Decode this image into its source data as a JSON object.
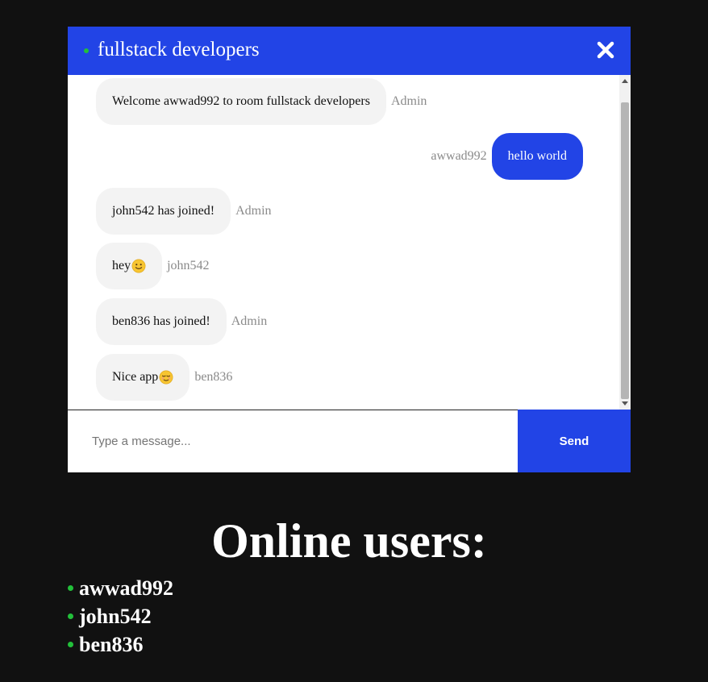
{
  "chat": {
    "room_title": "fullstack developers",
    "close_icon": "close-icon",
    "messages": [
      {
        "text": "Welcome awwad992 to room fullstack developers",
        "sender": "Admin",
        "own": false
      },
      {
        "text": "hello world",
        "sender": "awwad992",
        "own": true
      },
      {
        "text": "john542 has joined!",
        "sender": "Admin",
        "own": false
      },
      {
        "text": "hey",
        "sender": "john542",
        "own": false,
        "emoji": "smiling-face-emoji"
      },
      {
        "text": "ben836 has joined!",
        "sender": "Admin",
        "own": false
      },
      {
        "text": "Nice app",
        "sender": "ben836",
        "own": false,
        "emoji": "relieved-face-emoji"
      }
    ],
    "input_placeholder": "Type a message...",
    "input_value": "",
    "send_label": "Send"
  },
  "online": {
    "heading": "Online users:",
    "users": [
      "awwad992",
      "john542",
      "ben836"
    ]
  },
  "colors": {
    "accent": "#2244e6",
    "online": "#22c03a",
    "background": "#111111",
    "bubble": "#f3f3f3",
    "sender": "#8a8a8a"
  }
}
